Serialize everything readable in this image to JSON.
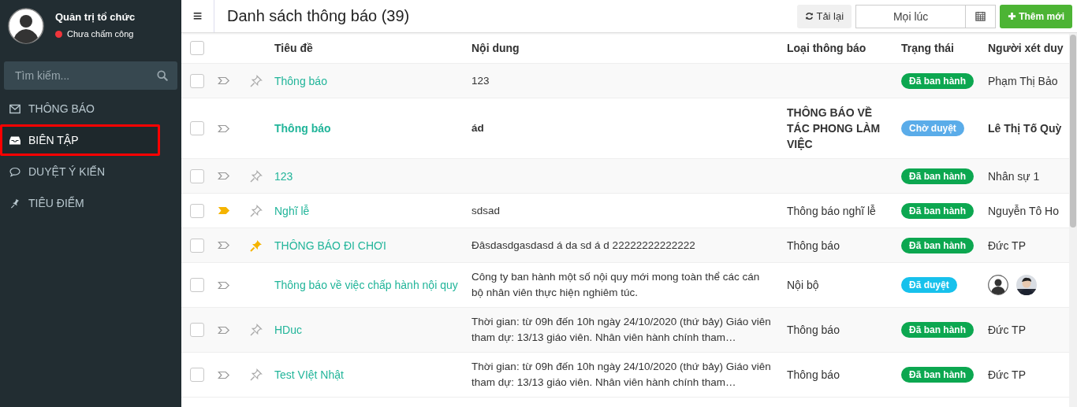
{
  "user": {
    "name": "Quản trị tổ chức",
    "status": "Chưa chấm công"
  },
  "search": {
    "placeholder": "Tìm kiếm..."
  },
  "sidebar": {
    "items": [
      {
        "label": "THÔNG BÁO",
        "selected": false
      },
      {
        "label": "BIÊN TẬP",
        "selected": true
      },
      {
        "label": "DUYỆT Ý KIẾN",
        "selected": false
      },
      {
        "label": "TIÊU ĐIỂM",
        "selected": false
      }
    ]
  },
  "header": {
    "menu_icon": "≡",
    "title": "Danh sách thông báo (39)",
    "reload_button": "Tải lại",
    "date_filter": "Mọi lúc",
    "add_button": "Thêm mới"
  },
  "table": {
    "select_all": {
      "checked": false
    },
    "columns": [
      "Tiêu đề",
      "Nội dung",
      "Loại thông báo",
      "Trạng thái",
      "Người xét duy"
    ],
    "rows": [
      {
        "checked": false,
        "flagged": false,
        "pinned": false,
        "bold": false,
        "title": "Thông báo",
        "content": "123",
        "type": "",
        "status": "Đã ban hành",
        "color": "#0ca750",
        "reviewer": "Phạm Thị Bảo"
      },
      {
        "checked": false,
        "flagged": false,
        "bold": true,
        "title": "Thông báo",
        "content": "ád",
        "type": "THÔNG BÁO VỀ TÁC PHONG LÀM VIỆC",
        "status": "Chờ duyệt",
        "color": "#5aace9",
        "reviewer": "Lê Thị Tố Quỳ"
      },
      {
        "checked": false,
        "flagged": false,
        "pinned": false,
        "bold": false,
        "title": "123",
        "content": "",
        "type": "",
        "status": "Đã ban hành",
        "color": "#0ca750",
        "reviewer": "Nhân sự 1"
      },
      {
        "checked": false,
        "flagged": true,
        "pinned": false,
        "bold": false,
        "title": "Nghĩ lễ",
        "content": "sdsad",
        "type": "Thông báo nghĩ lễ",
        "status": "Đã ban hành",
        "color": "#0ca750",
        "reviewer": "Nguyễn Tô Ho"
      },
      {
        "checked": false,
        "flagged": false,
        "pinned": true,
        "bold": false,
        "title": "THÔNG BÁO ĐI CHƠI",
        "content": "Đâsdasdgasdasd á da sd á d  22222222222222",
        "type": "Thông báo",
        "status": "Đã ban hành",
        "color": "#0ca750",
        "reviewer": "Đức TP"
      },
      {
        "checked": false,
        "flagged": false,
        "bold": false,
        "title": "Thông báo về việc chấp hành nội quy",
        "content": "Công ty ban hành một số nội quy mới mong toàn thể các cán bộ nhân viên thực hiện nghiêm túc.",
        "type": "Nội bộ",
        "status": "Đã duyệt",
        "color": "#17c1ec",
        "reviewer_avatars": [
          {
            "kind": "default"
          },
          {
            "kind": "picture"
          }
        ]
      },
      {
        "checked": false,
        "flagged": false,
        "pinned": false,
        "bold": false,
        "title": "HDuc",
        "content": "Thời gian: từ 09h đến 10h ngày 24/10/2020 (thứ bảy) Giáo viên tham dự: 13/13 giáo viên. Nhân viên hành chính tham…",
        "type": "Thông báo",
        "status": "Đã ban hành",
        "color": "#0ca750",
        "reviewer": "Đức TP"
      },
      {
        "checked": false,
        "flagged": false,
        "pinned": false,
        "bold": false,
        "title": "Test VIệt Nhật",
        "content": "Thời gian: từ 09h đến 10h ngày 24/10/2020 (thứ bảy) Giáo viên tham dự: 13/13 giáo viên. Nhân viên hành chính tham…",
        "type": "Thông báo",
        "status": "Đã ban hành",
        "color": "#0ca750",
        "reviewer": "Đức TP"
      }
    ]
  }
}
